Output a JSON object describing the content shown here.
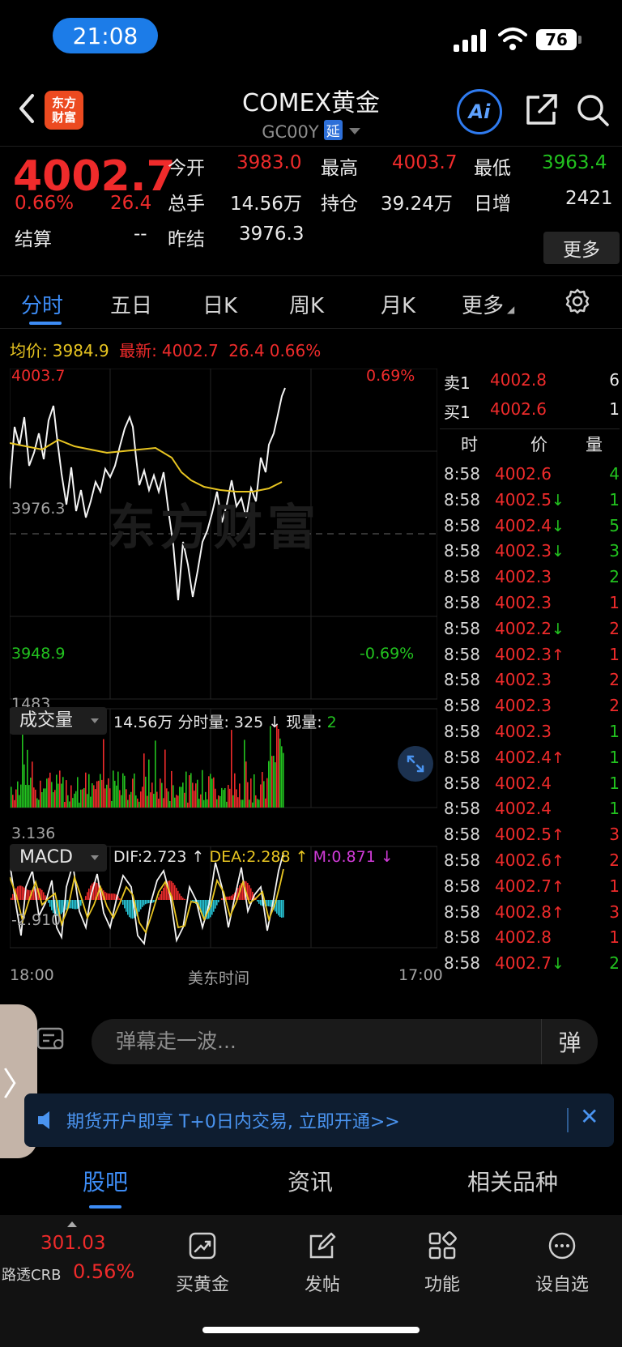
{
  "status": {
    "time": "21:08",
    "battery": "76"
  },
  "header": {
    "logo": "东方\n财富",
    "title": "COMEX黄金",
    "code": "GC00Y",
    "delay_badge": "延",
    "ai": "Ai"
  },
  "quote": {
    "price": "4002.7",
    "pct": "0.66%",
    "change": "26.4",
    "open_label": "今开",
    "open": "3983.0",
    "high_label": "最高",
    "high": "4003.7",
    "low_label": "最低",
    "low": "3963.4",
    "volume_label": "总手",
    "volume": "14.56万",
    "position_label": "持仓",
    "position": "39.24万",
    "daily_inc_label": "日增",
    "daily_inc": "2421",
    "settle_label": "结算",
    "settle": "--",
    "prev_settle_label": "昨结",
    "prev_settle": "3976.3",
    "more": "更多"
  },
  "tabs": [
    "分时",
    "五日",
    "日K",
    "周K",
    "月K",
    "更多"
  ],
  "avg_line": {
    "avg_label": "均价:",
    "avg": "3984.9",
    "latest_label": "最新:",
    "latest": "4002.7",
    "change": "26.4",
    "pct": "0.66%"
  },
  "chart_labels": {
    "top_price": "4003.7",
    "top_pct": "0.69%",
    "mid_price": "3976.3",
    "bottom_price": "3948.9",
    "bottom_pct": "-0.69%",
    "watermark": "东方财富",
    "vol_max": "1483",
    "macd_max": "3.136",
    "macd_min": "-2.910",
    "x_start": "18:00",
    "x_mid": "美东时间",
    "x_end": "17:00"
  },
  "volume_panel": {
    "name": "成交量",
    "total": "14.56万",
    "tick_vol_label": "分时量:",
    "tick_vol": "325 ↓",
    "now_label": "现量:",
    "now": "2"
  },
  "macd_panel": {
    "name": "MACD",
    "dif": "DIF:2.723 ↑",
    "dea": "DEA:2.288 ↑",
    "m": "M:0.871 ↓"
  },
  "order_book": {
    "sell_label": "卖1",
    "sell_price": "4002.8",
    "sell_vol": "6",
    "buy_label": "买1",
    "buy_price": "4002.6",
    "buy_vol": "1"
  },
  "tick_header": {
    "time": "时",
    "price": "价",
    "vol": "量"
  },
  "ticks": [
    {
      "t": "8:58",
      "p": "4002.6",
      "a": "",
      "v": "4",
      "pc": "red",
      "vc": "green"
    },
    {
      "t": "8:58",
      "p": "4002.5",
      "a": "↓",
      "v": "1",
      "pc": "red",
      "vc": "green"
    },
    {
      "t": "8:58",
      "p": "4002.4",
      "a": "↓",
      "v": "5",
      "pc": "red",
      "vc": "green"
    },
    {
      "t": "8:58",
      "p": "4002.3",
      "a": "↓",
      "v": "3",
      "pc": "red",
      "vc": "green"
    },
    {
      "t": "8:58",
      "p": "4002.3",
      "a": "",
      "v": "2",
      "pc": "red",
      "vc": "green"
    },
    {
      "t": "8:58",
      "p": "4002.3",
      "a": "",
      "v": "1",
      "pc": "red",
      "vc": "red"
    },
    {
      "t": "8:58",
      "p": "4002.2",
      "a": "↓",
      "v": "2",
      "pc": "red",
      "vc": "red"
    },
    {
      "t": "8:58",
      "p": "4002.3",
      "a": "↑",
      "v": "1",
      "pc": "red",
      "vc": "red"
    },
    {
      "t": "8:58",
      "p": "4002.3",
      "a": "",
      "v": "2",
      "pc": "red",
      "vc": "red"
    },
    {
      "t": "8:58",
      "p": "4002.3",
      "a": "",
      "v": "2",
      "pc": "red",
      "vc": "red"
    },
    {
      "t": "8:58",
      "p": "4002.3",
      "a": "",
      "v": "1",
      "pc": "red",
      "vc": "green"
    },
    {
      "t": "8:58",
      "p": "4002.4",
      "a": "↑",
      "v": "1",
      "pc": "red",
      "vc": "green"
    },
    {
      "t": "8:58",
      "p": "4002.4",
      "a": "",
      "v": "1",
      "pc": "red",
      "vc": "green"
    },
    {
      "t": "8:58",
      "p": "4002.4",
      "a": "",
      "v": "1",
      "pc": "red",
      "vc": "green"
    },
    {
      "t": "8:58",
      "p": "4002.5",
      "a": "↑",
      "v": "3",
      "pc": "red",
      "vc": "red"
    },
    {
      "t": "8:58",
      "p": "4002.6",
      "a": "↑",
      "v": "2",
      "pc": "red",
      "vc": "red"
    },
    {
      "t": "8:58",
      "p": "4002.7",
      "a": "↑",
      "v": "1",
      "pc": "red",
      "vc": "red"
    },
    {
      "t": "8:58",
      "p": "4002.8",
      "a": "↑",
      "v": "3",
      "pc": "red",
      "vc": "red"
    },
    {
      "t": "8:58",
      "p": "4002.8",
      "a": "",
      "v": "1",
      "pc": "red",
      "vc": "red"
    },
    {
      "t": "8:58",
      "p": "4002.7",
      "a": "↓",
      "v": "2",
      "pc": "red",
      "vc": "green"
    }
  ],
  "danmaku": {
    "placeholder": "弹幕走一波...",
    "toggle": "弹"
  },
  "promo": {
    "text": "期货开户即享 T+0日内交易, 立即开通>>"
  },
  "sub_tabs": [
    "股吧",
    "资讯",
    "相关品种"
  ],
  "bottom_bar": {
    "index_value": "301.03",
    "index_name": "路透CRB",
    "index_pct": "0.56%",
    "items": [
      "买黄金",
      "发帖",
      "功能",
      "设自选"
    ]
  }
}
